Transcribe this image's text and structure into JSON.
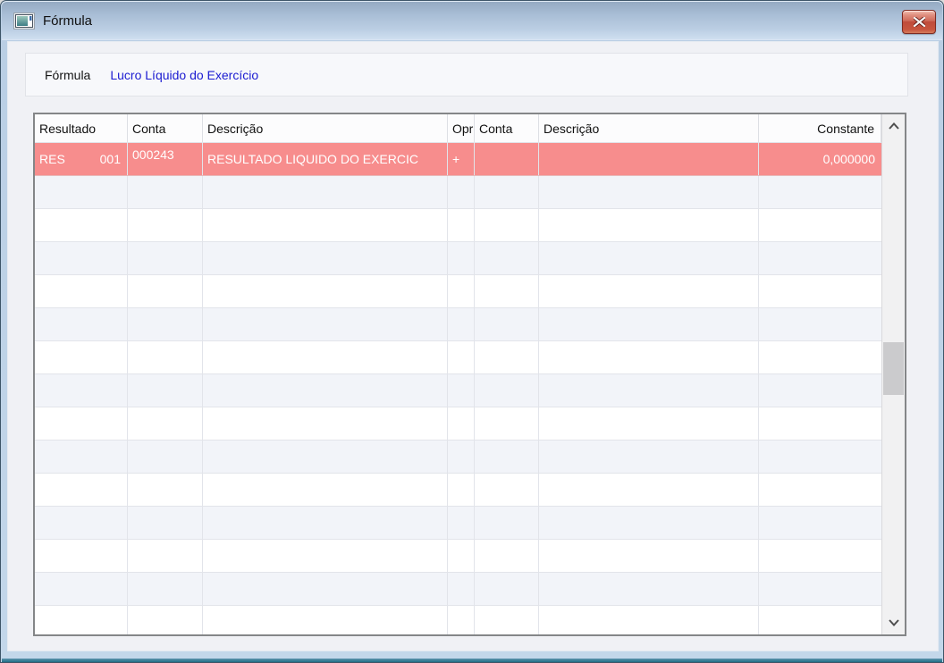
{
  "window": {
    "title": "Fórmula",
    "icons": {
      "app": "form-window-icon",
      "close": "x-close-icon",
      "scroll_up": "chevron-up",
      "scroll_down": "chevron-down"
    }
  },
  "formula_panel": {
    "label": "Fórmula",
    "value": "Lucro Líquido do Exercício",
    "value_color": "#1b1bd1"
  },
  "grid": {
    "columns": [
      {
        "label": "Resultado"
      },
      {
        "label": "Conta"
      },
      {
        "label": "Descrição"
      },
      {
        "label": "Opr"
      },
      {
        "label": "Conta"
      },
      {
        "label": "Descrição"
      },
      {
        "label": "Constante"
      }
    ],
    "selected_row": {
      "resultado": "RES",
      "sequencia": "001",
      "conta": "000243",
      "descricao": "RESULTADO LIQUIDO DO EXERCIC",
      "opr": "+",
      "conta2": "",
      "descricao2": "",
      "constante": "0,000000"
    },
    "empty_row_count": 14,
    "colors": {
      "selected_bg": "#f78d8d",
      "alt_row_bg": "#f2f4f9",
      "row_bg": "#ffffff"
    }
  }
}
